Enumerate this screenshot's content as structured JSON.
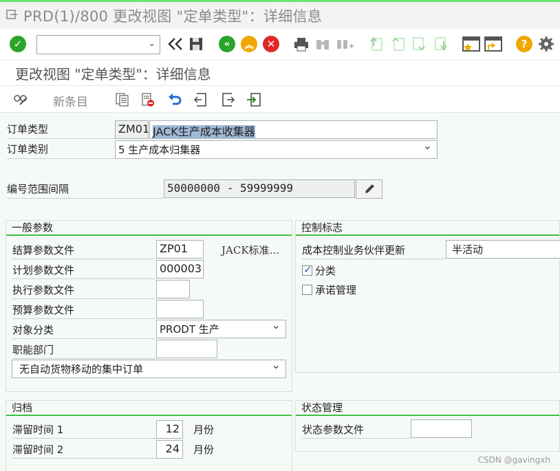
{
  "window": {
    "title": "PRD(1)/800 更改视图 \"定单类型\"：详细信息"
  },
  "toolbar": {
    "command_placeholder": ""
  },
  "screen": {
    "title": "更改视图 \"定单类型\"：详细信息"
  },
  "app_toolbar": {
    "new_entries_label": "新条目"
  },
  "header": {
    "order_type_label": "订单类型",
    "order_type_code": "ZM01",
    "order_type_desc": "JACK生产成本收集器",
    "order_category_label": "订单类别",
    "order_category_value": "5 生产成本归集器",
    "number_range_label": "编号范围间隔",
    "number_range_value": "50000000  -  59999999"
  },
  "general_params": {
    "title": "一般参数",
    "settlement_label": "结算参数文件",
    "settlement_value": "ZP01",
    "settlement_text": "JACK标准…",
    "planning_label": "计划参数文件",
    "planning_value": "000003",
    "execution_label": "执行参数文件",
    "execution_value": "",
    "budget_label": "预算参数文件",
    "budget_value": "",
    "object_class_label": "对象分类",
    "object_class_value": "PRODT 生产",
    "functional_area_label": "职能部门",
    "functional_area_value": "",
    "goods_movement_value": "无自动货物移动的集中订单"
  },
  "control_indicators": {
    "title": "控制标志",
    "partner_update_label": "成本控制业务伙伴更新",
    "partner_update_value": "半活动",
    "classification_label": "分类",
    "classification_checked": true,
    "commitment_label": "承诺管理",
    "commitment_checked": false
  },
  "archiving": {
    "title": "归档",
    "residence1_label": "滞留时间 1",
    "residence1_value": "12",
    "residence1_unit": "月份",
    "residence2_label": "滞留时间 2",
    "residence2_value": "24",
    "residence2_unit": "月份"
  },
  "status_mgmt": {
    "title": "状态管理",
    "status_profile_label": "状态参数文件",
    "status_profile_value": ""
  },
  "watermark": "CSDN @gavingxh",
  "colors": {
    "accent_green": "#3ec13e",
    "check_green": "#2aa52a",
    "cancel_red": "#e0282a",
    "help_orange": "#f0a800"
  }
}
